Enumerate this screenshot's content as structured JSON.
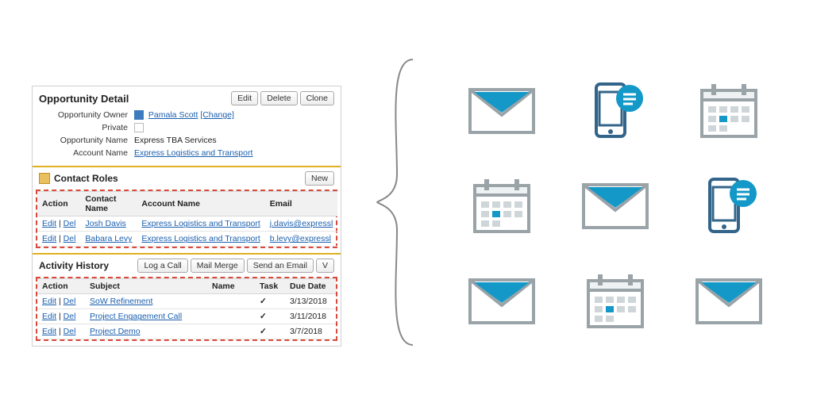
{
  "panel": {
    "title": "Opportunity Detail",
    "buttons": {
      "edit": "Edit",
      "delete": "Delete",
      "clone": "Clone"
    },
    "fields": {
      "owner_label": "Opportunity Owner",
      "owner_value": "Pamala Scott",
      "owner_change": "[Change]",
      "private_label": "Private",
      "name_label": "Opportunity Name",
      "name_value": "Express TBA Services",
      "account_label": "Account Name",
      "account_value": "Express Logistics and Transport"
    }
  },
  "contact_roles": {
    "title": "Contact Roles",
    "new_btn": "New",
    "cols": {
      "action": "Action",
      "name": "Contact Name",
      "account": "Account Name",
      "email": "Email"
    },
    "action_edit": "Edit",
    "action_del": "Del",
    "rows": [
      {
        "name": "Josh Davis",
        "account": "Express Logistics and Transport",
        "email": "j.davis@expressl"
      },
      {
        "name": "Babara Levy",
        "account": "Express Logistics and Transport",
        "email": "b.levy@expressl"
      }
    ]
  },
  "activity_history": {
    "title": "Activity History",
    "buttons": {
      "log": "Log a Call",
      "mail": "Mail Merge",
      "send": "Send an Email",
      "last": "V"
    },
    "cols": {
      "action": "Action",
      "subject": "Subject",
      "name": "Name",
      "task": "Task",
      "due": "Due Date"
    },
    "action_edit": "Edit",
    "action_del": "Del",
    "rows": [
      {
        "subject": "SoW Refinement",
        "name": "",
        "task": "✓",
        "due": "3/13/2018"
      },
      {
        "subject": "Project Engagement Call",
        "name": "",
        "task": "✓",
        "due": "3/11/2018"
      },
      {
        "subject": "Project Demo",
        "name": "",
        "task": "✓",
        "due": "3/7/2018"
      }
    ]
  },
  "icons": [
    "mail-icon",
    "phone-chat-icon",
    "calendar-icon",
    "calendar-icon",
    "mail-icon",
    "phone-chat-icon",
    "mail-icon",
    "calendar-icon",
    "mail-icon"
  ],
  "colors": {
    "accent": "#1398c8",
    "stroke": "#9aa3a7"
  }
}
